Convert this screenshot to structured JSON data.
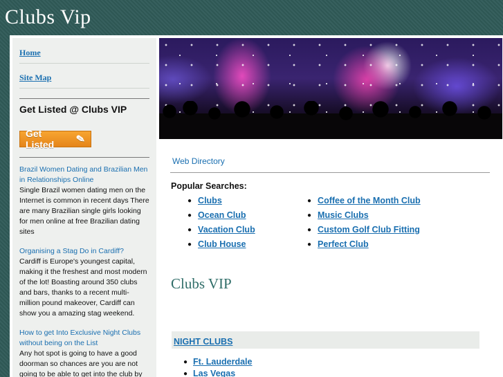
{
  "site": {
    "title": "Clubs Vip"
  },
  "sidebar": {
    "nav": [
      {
        "label": "Home"
      },
      {
        "label": "Site Map"
      }
    ],
    "listed_heading": "Get Listed @ Clubs VIP",
    "listed_button": "Get Listed",
    "articles": [
      {
        "title": "Brazil Women Dating and Brazilian Men in Relationships Online",
        "text": "Single Brazil women dating men on the Internet is common in recent days There are many Brazilian single girls looking for men online at free Brazilian dating sites"
      },
      {
        "title": "Organising a Stag Do in Cardiff?",
        "text": "Cardiff is Europe's youngest capital, making it the freshest and most modern of the lot! Boasting around 350 clubs and bars, thanks to a recent multi-million pound makeover, Cardiff can show you a amazing stag weekend."
      },
      {
        "title": "How to get Into Exclusive Night Clubs without being on the List",
        "text": "Any hot spot is going to have a good doorman so chances are you are not going to be able to get into the club by tipping the bouncer unless it's a really"
      }
    ]
  },
  "main": {
    "web_directory": "Web Directory",
    "popular_label": "Popular Searches:",
    "popular_col1": [
      "Clubs",
      "Ocean Club",
      "Vacation Club",
      "Club House"
    ],
    "popular_col2": [
      "Coffee of the Month Club",
      "Music Clubs",
      "Custom Golf Club Fitting",
      "Perfect Club"
    ],
    "heading": "Clubs VIP",
    "night_clubs": "NIGHT CLUBS",
    "cities": [
      "Ft. Lauderdale",
      "Las Vegas"
    ]
  },
  "colors": {
    "background": "#2f5a57",
    "link": "#1a6fb0",
    "heading": "#2f6d68",
    "button": "#f29a2a"
  }
}
